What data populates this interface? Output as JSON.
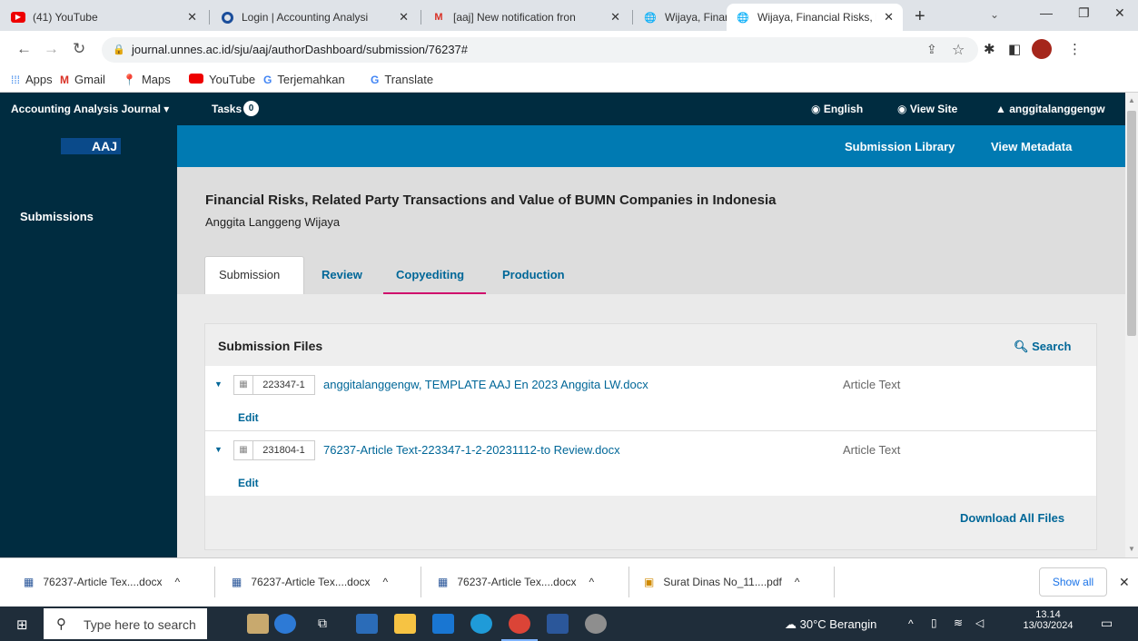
{
  "browser": {
    "tabs": [
      {
        "title": "(41) YouTube",
        "icon": "youtube-icon"
      },
      {
        "title": "Login | Accounting Analysi",
        "icon": "aaj-icon"
      },
      {
        "title": "[aaj] New notification fron",
        "icon": "gmail-icon"
      },
      {
        "title": "Wijaya, Financial Risks, Re",
        "icon": "globe-icon"
      },
      {
        "title": "Wijaya, Financial Risks, Re",
        "icon": "globe-icon"
      }
    ],
    "url": "journal.unnes.ac.id/sju/aaj/authorDashboard/submission/76237#",
    "bookmarks": [
      "Apps",
      "Gmail",
      "Maps",
      "YouTube",
      "Terjemahkan",
      "Translate"
    ]
  },
  "app": {
    "context": "Accounting Analysis Journal",
    "tasks_label": "Tasks",
    "tasks_count": "0",
    "language": "English",
    "view_site": "View Site",
    "user": "anggitalanggengw",
    "logo": "AAJ",
    "submission_library": "Submission Library",
    "view_metadata": "View Metadata",
    "nav_submissions": "Submissions"
  },
  "submission": {
    "title": "Financial Risks, Related Party Transactions and Value of BUMN Companies in Indonesia",
    "author": "Anggita Langgeng Wijaya",
    "tabs": [
      "Submission",
      "Review",
      "Copyediting",
      "Production"
    ]
  },
  "files_panel": {
    "heading": "Submission Files",
    "search": "Search",
    "files": [
      {
        "id": "223347-1",
        "name": "anggitalanggengw, TEMPLATE AAJ En 2023 Anggita LW.docx",
        "type": "Article Text",
        "edit": "Edit"
      },
      {
        "id": "231804-1",
        "name": "76237-Article Text-223347-1-2-20231112-to Review.docx",
        "type": "Article Text",
        "edit": "Edit"
      }
    ],
    "download_all": "Download All Files"
  },
  "downloads": {
    "items": [
      "76237-Article Tex....docx",
      "76237-Article Tex....docx",
      "76237-Article Tex....docx",
      "Surat Dinas No_11....pdf"
    ],
    "show_all": "Show all"
  },
  "taskbar": {
    "search_placeholder": "Type here to search",
    "weather": "30°C Berangin",
    "time": "13.14",
    "date": "13/03/2024"
  }
}
